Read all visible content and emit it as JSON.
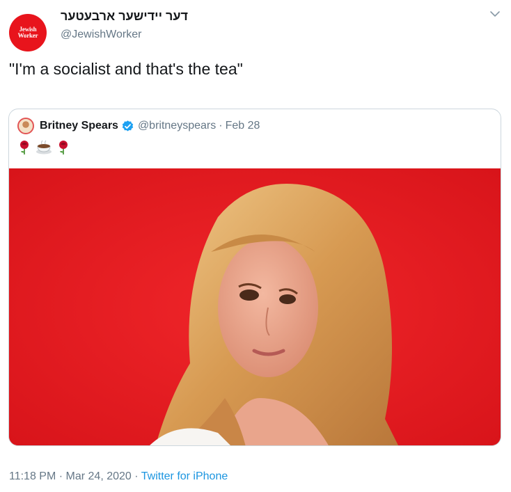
{
  "author": {
    "display_name": "דער יידישער ארבעטער",
    "handle": "@JewishWorker",
    "avatar_text_line1": "Jewish",
    "avatar_text_line2": "Worker",
    "avatar_color": "#e8141c"
  },
  "tweet": {
    "text": "\"I'm a socialist and that's the tea\""
  },
  "quoted_tweet": {
    "author_name": "Britney Spears",
    "verified": true,
    "handle": "@britneyspears",
    "separator": "·",
    "date": "Feb 28",
    "emojis": [
      "rose-icon",
      "tea-cup-icon",
      "rose-icon"
    ],
    "image_background_color": "#e9191e"
  },
  "footer": {
    "time": "11:18 PM",
    "separator1": "·",
    "date": "Mar 24, 2020",
    "separator2": "·",
    "source": "Twitter for iPhone"
  },
  "colors": {
    "link": "#1b95e0",
    "secondary_text": "#657786",
    "border": "#ccd6dd"
  }
}
